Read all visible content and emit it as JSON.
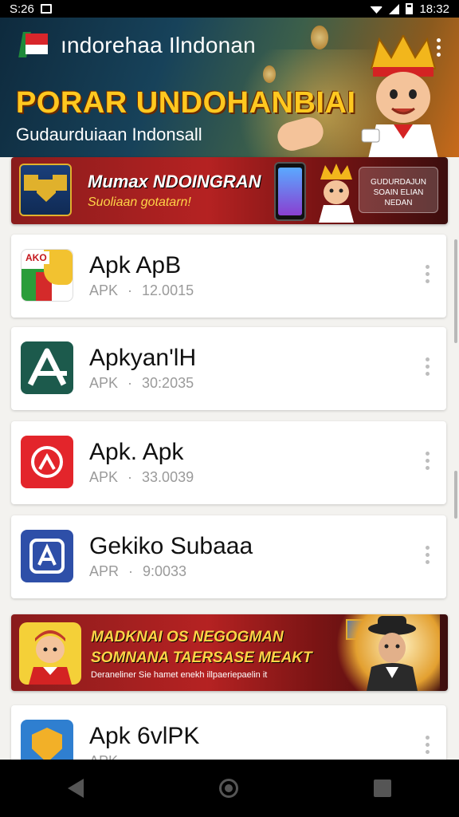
{
  "status_bar": {
    "left_time": "S:26",
    "right_time": "18:32"
  },
  "header": {
    "app_title": "ındorehaa Ilndonan",
    "headline": "PORAR UNDOHANBIAI",
    "subtitle": "Gudaurduiaan Indonsall"
  },
  "promo_top": {
    "title": "Mumax NDOINGRAN",
    "subtitle": "Suoliaan gotatarn!",
    "cta": "GUDURDAJUN SOAIN ELIAN NEDAN"
  },
  "apps": [
    {
      "name": "Apk ApB",
      "type": "APK",
      "version": "12.0015",
      "icon": "colorful-tag-icon",
      "icon_tag": "AKO"
    },
    {
      "name": "Apkyan'lH",
      "type": "APK",
      "version": "30:2035",
      "icon": "a-letter-icon"
    },
    {
      "name": "Apk. Apk",
      "type": "APK",
      "version": "33.0039",
      "icon": "red-circle-icon"
    },
    {
      "name": "Gekiko Subaaa",
      "type": "APR",
      "version": "9:0033",
      "icon": "blue-frame-icon"
    },
    {
      "name": "Apk 6vlPK",
      "type": "APK",
      "version": "",
      "icon": "shield-icon"
    }
  ],
  "promo_bottom": {
    "title_line1": "MADKNAI OS NEGOGMAN",
    "title_line2": "SOMNANA TAERSASE MEAKT",
    "subtitle": "Deraneliner Sie hamet enekh illpaeriepaelin it"
  },
  "colors": {
    "status_bar": "#000000",
    "headline_yellow": "#ffc820",
    "promo_red": "#b52222",
    "card_bg": "#ffffff",
    "page_bg": "#f3f2ef"
  }
}
